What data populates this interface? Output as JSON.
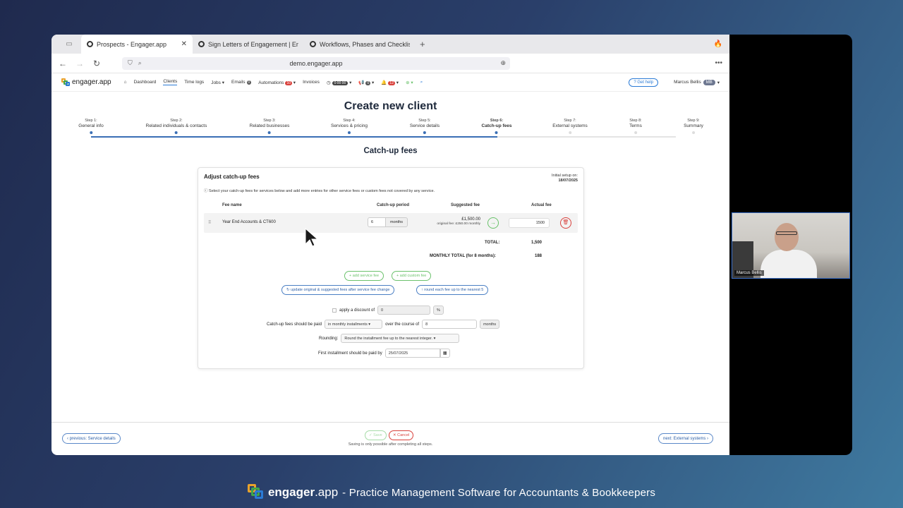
{
  "browser": {
    "tabs": [
      {
        "label": "Prospects - Engager.app",
        "active": true
      },
      {
        "label": "Sign Letters of Engagement | Eng",
        "active": false
      },
      {
        "label": "Workflows, Phases and Checklist",
        "active": false
      }
    ],
    "url": "demo.engager.app"
  },
  "appnav": {
    "logo": "engager.app",
    "items": [
      "Dashboard",
      "Clients",
      "Time logs",
      "Jobs",
      "Emails",
      "Automations",
      "Invoices"
    ],
    "emails_badge": "0",
    "automations_badge": "10",
    "timer": "0:00:00",
    "announce_badge": "0",
    "bell_badge": "12",
    "help": "Get help",
    "user_name": "Marcus Bellis",
    "user_initials": "MB"
  },
  "page": {
    "title": "Create new client",
    "section_title": "Catch-up fees"
  },
  "steps": [
    {
      "n": "Step 1:",
      "label": "General info"
    },
    {
      "n": "Step 2:",
      "label": "Related individuals & contacts"
    },
    {
      "n": "Step 3:",
      "label": "Related businesses"
    },
    {
      "n": "Step 4:",
      "label": "Services & pricing"
    },
    {
      "n": "Step 5:",
      "label": "Service details"
    },
    {
      "n": "Step 6:",
      "label": "Catch-up fees"
    },
    {
      "n": "Step 7:",
      "label": "External systems"
    },
    {
      "n": "Step 8:",
      "label": "Terms"
    },
    {
      "n": "Step 9:",
      "label": "Summary"
    }
  ],
  "card": {
    "heading": "Adjust catch-up fees",
    "setup_label": "Initial setup on:",
    "setup_date": "18/07/2025",
    "description": "Select your catch-up fees for services below and add more entries for other service fees or custom fees not covered by any service.",
    "headers": {
      "fee_name": "Fee name",
      "period": "Catch-up period",
      "suggested": "Suggested fee",
      "actual": "Actual fee"
    },
    "row": {
      "fee_name": "Year End Accounts & CT600",
      "period": "6",
      "period_unit": "months",
      "suggested": "£1,500.00",
      "original": "original fee: £250.00 monthly",
      "actual": "1500"
    },
    "total_label": "TOTAL:",
    "total_value": "1,500",
    "monthly_label": "MONTHLY TOTAL (for 8 months):",
    "monthly_value": "188",
    "add_service_fee": "+ add service fee",
    "add_custom_fee": "+ add custom fee",
    "update_fees": "update original & suggested fees after service fee change",
    "round_fees": "round each fee up to the nearest 5",
    "discount_label": "apply a discount of",
    "discount_value": "0",
    "discount_unit": "%",
    "paid_label": "Catch-up fees should be paid",
    "paid_value": "in monthly installments",
    "over_label": "over the course of",
    "over_value": "8",
    "over_unit": "months",
    "rounding_label": "Rounding:",
    "rounding_value": "Round the installment fee up to the nearest integer.",
    "first_label": "First installment should be paid by",
    "first_value": "25/07/2025"
  },
  "footer": {
    "previous": "previous: Service details",
    "next": "next: External systems",
    "save": "Save",
    "cancel": "Cancel",
    "note": "Saving is only possible after completing all steps."
  },
  "webcam": {
    "name": "Marcus Bellis"
  },
  "tagline": {
    "brand_bold": "engager",
    "brand_light": ".app",
    "rest": "- Practice Management Software for Accountants & Bookkeepers"
  },
  "colors": {
    "accent": "#2b7bd6",
    "green": "#6cc26d",
    "red": "#d9413c"
  }
}
